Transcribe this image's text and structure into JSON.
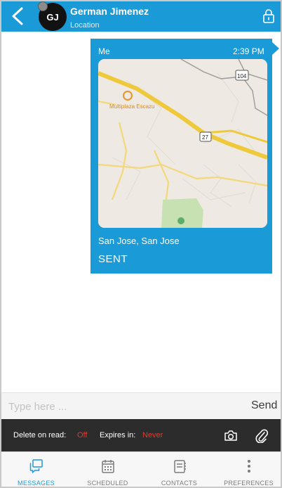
{
  "header": {
    "contact_name": "German Jimenez",
    "contact_subtitle": "Location",
    "avatar_initials": "GJ",
    "bg_color": "#1b9ad8"
  },
  "message": {
    "sender": "Me",
    "time": "2:39 PM",
    "location_text": "San Jose, San Jose",
    "status": "SENT",
    "map": {
      "place_label": "Multiplaza Escazu",
      "route_badges": [
        "104",
        "27"
      ]
    }
  },
  "compose": {
    "placeholder": "Type here ...",
    "value": "",
    "send_label": "Send"
  },
  "options": {
    "delete_label": "Delete on read:",
    "delete_value": "Off",
    "expires_label": "Expires in:",
    "expires_value": "Never",
    "value_color": "#e53a2c"
  },
  "tabs": [
    {
      "label": "MESSAGES",
      "icon": "messages-icon",
      "active": true
    },
    {
      "label": "SCHEDULED",
      "icon": "calendar-icon",
      "active": false
    },
    {
      "label": "CONTACTS",
      "icon": "contacts-icon",
      "active": false
    },
    {
      "label": "PREFERENCES",
      "icon": "more-vertical-icon",
      "active": false
    }
  ]
}
